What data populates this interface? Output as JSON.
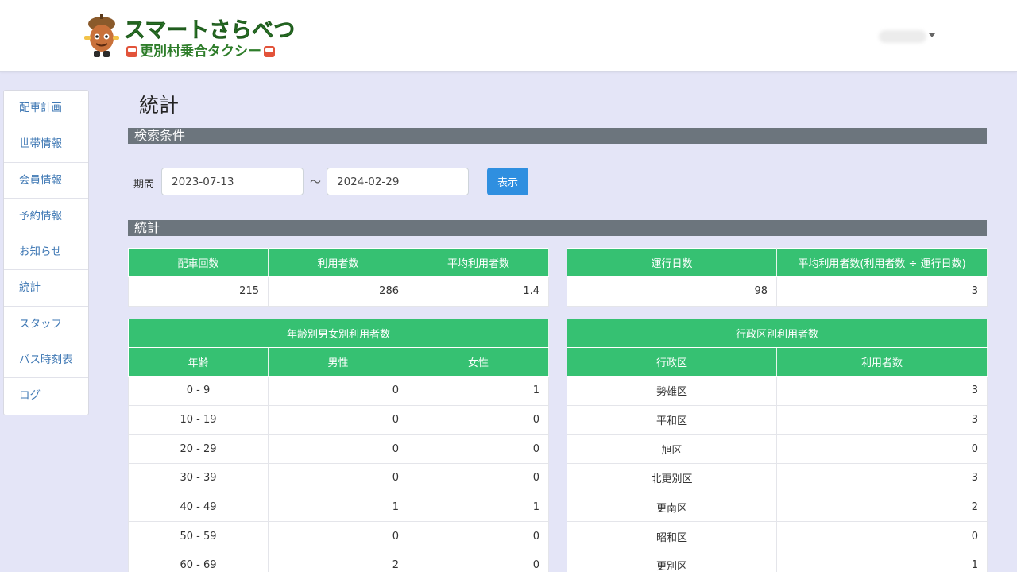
{
  "header": {
    "logo_title": "スマートさらべつ",
    "logo_subtitle": "更別村乗合タクシー",
    "brand_color": "#2e7d2a"
  },
  "sidebar": {
    "items": [
      {
        "label": "配車計画"
      },
      {
        "label": "世帯情報"
      },
      {
        "label": "会員情報"
      },
      {
        "label": "予約情報"
      },
      {
        "label": "お知らせ"
      },
      {
        "label": "統計"
      },
      {
        "label": "スタッフ"
      },
      {
        "label": "バス時刻表"
      },
      {
        "label": "ログ"
      }
    ]
  },
  "main": {
    "title": "統計",
    "search_section": "検索条件",
    "search": {
      "period_label": "期間",
      "from": "2023-07-13",
      "tilde": "～",
      "to": "2024-02-29",
      "show_button": "表示"
    },
    "stats_section": "統計",
    "summary1": {
      "headers": [
        "配車回数",
        "利用者数",
        "平均利用者数"
      ],
      "values": [
        "215",
        "286",
        "1.4"
      ]
    },
    "summary2": {
      "headers": [
        "運行日数",
        "平均利用者数(利用者数 ÷ 運行日数)"
      ],
      "values": [
        "98",
        "3"
      ]
    },
    "age_table": {
      "title": "年齢別男女別利用者数",
      "headers": [
        "年齢",
        "男性",
        "女性"
      ],
      "rows": [
        [
          "0 - 9",
          "0",
          "1"
        ],
        [
          "10 - 19",
          "0",
          "0"
        ],
        [
          "20 - 29",
          "0",
          "0"
        ],
        [
          "30 - 39",
          "0",
          "0"
        ],
        [
          "40 - 49",
          "1",
          "1"
        ],
        [
          "50 - 59",
          "0",
          "0"
        ],
        [
          "60 - 69",
          "2",
          "0"
        ]
      ]
    },
    "district_table": {
      "title": "行政区別利用者数",
      "headers": [
        "行政区",
        "利用者数"
      ],
      "rows": [
        [
          "勢雄区",
          "3"
        ],
        [
          "平和区",
          "3"
        ],
        [
          "旭区",
          "0"
        ],
        [
          "北更別区",
          "3"
        ],
        [
          "更南区",
          "2"
        ],
        [
          "昭和区",
          "0"
        ],
        [
          "更別区",
          "1"
        ]
      ]
    }
  },
  "colors": {
    "table_header": "#36c172",
    "section_bar": "#6c757d",
    "primary_button": "#2f8fe0",
    "page_background": "#e4e5f7"
  }
}
